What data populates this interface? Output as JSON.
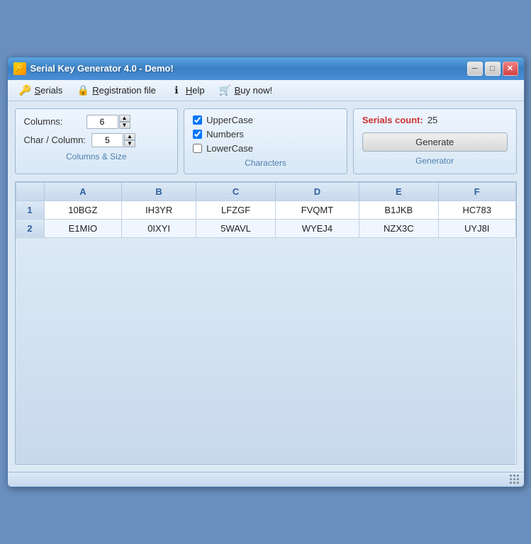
{
  "window": {
    "title": "Serial Key Generator 4.0 - Demo!",
    "icon": "🔑"
  },
  "titleButtons": {
    "minimize": "─",
    "maximize": "□",
    "close": "✕"
  },
  "menu": {
    "items": [
      {
        "id": "serials",
        "icon": "🔑",
        "label": "Serials",
        "underline": "S"
      },
      {
        "id": "registration",
        "icon": "🔒",
        "label": "Registration file",
        "underline": "R"
      },
      {
        "id": "help",
        "icon": "ℹ",
        "label": "Help",
        "underline": "H"
      },
      {
        "id": "buy",
        "icon": "🛒",
        "label": "Buy now!",
        "underline": "B"
      }
    ]
  },
  "columnsSection": {
    "label": "Columns & Size",
    "columnsLabel": "Columns:",
    "columnsValue": "6",
    "charColumnLabel": "Char / Column:",
    "charColumnValue": "5"
  },
  "charactersSection": {
    "label": "Characters",
    "options": [
      {
        "id": "uppercase",
        "label": "UpperCase",
        "checked": true
      },
      {
        "id": "numbers",
        "label": "Numbers",
        "checked": true
      },
      {
        "id": "lowercase",
        "label": "LowerCase",
        "checked": false
      }
    ]
  },
  "generatorSection": {
    "label": "Generator",
    "serialsCountLabel": "Serials count:",
    "serialsCountValue": "25",
    "generateLabel": "Generate"
  },
  "table": {
    "headers": [
      "",
      "A",
      "B",
      "C",
      "D",
      "E",
      "F"
    ],
    "rows": [
      {
        "rowNum": "1",
        "cells": [
          "10BGZ",
          "IH3YR",
          "LFZGF",
          "FVQMT",
          "B1JKB",
          "HC783"
        ]
      },
      {
        "rowNum": "2",
        "cells": [
          "E1MIO",
          "0IXYI",
          "5WAVL",
          "WYEJ4",
          "NZX3C",
          "UYJ8I"
        ]
      }
    ]
  }
}
